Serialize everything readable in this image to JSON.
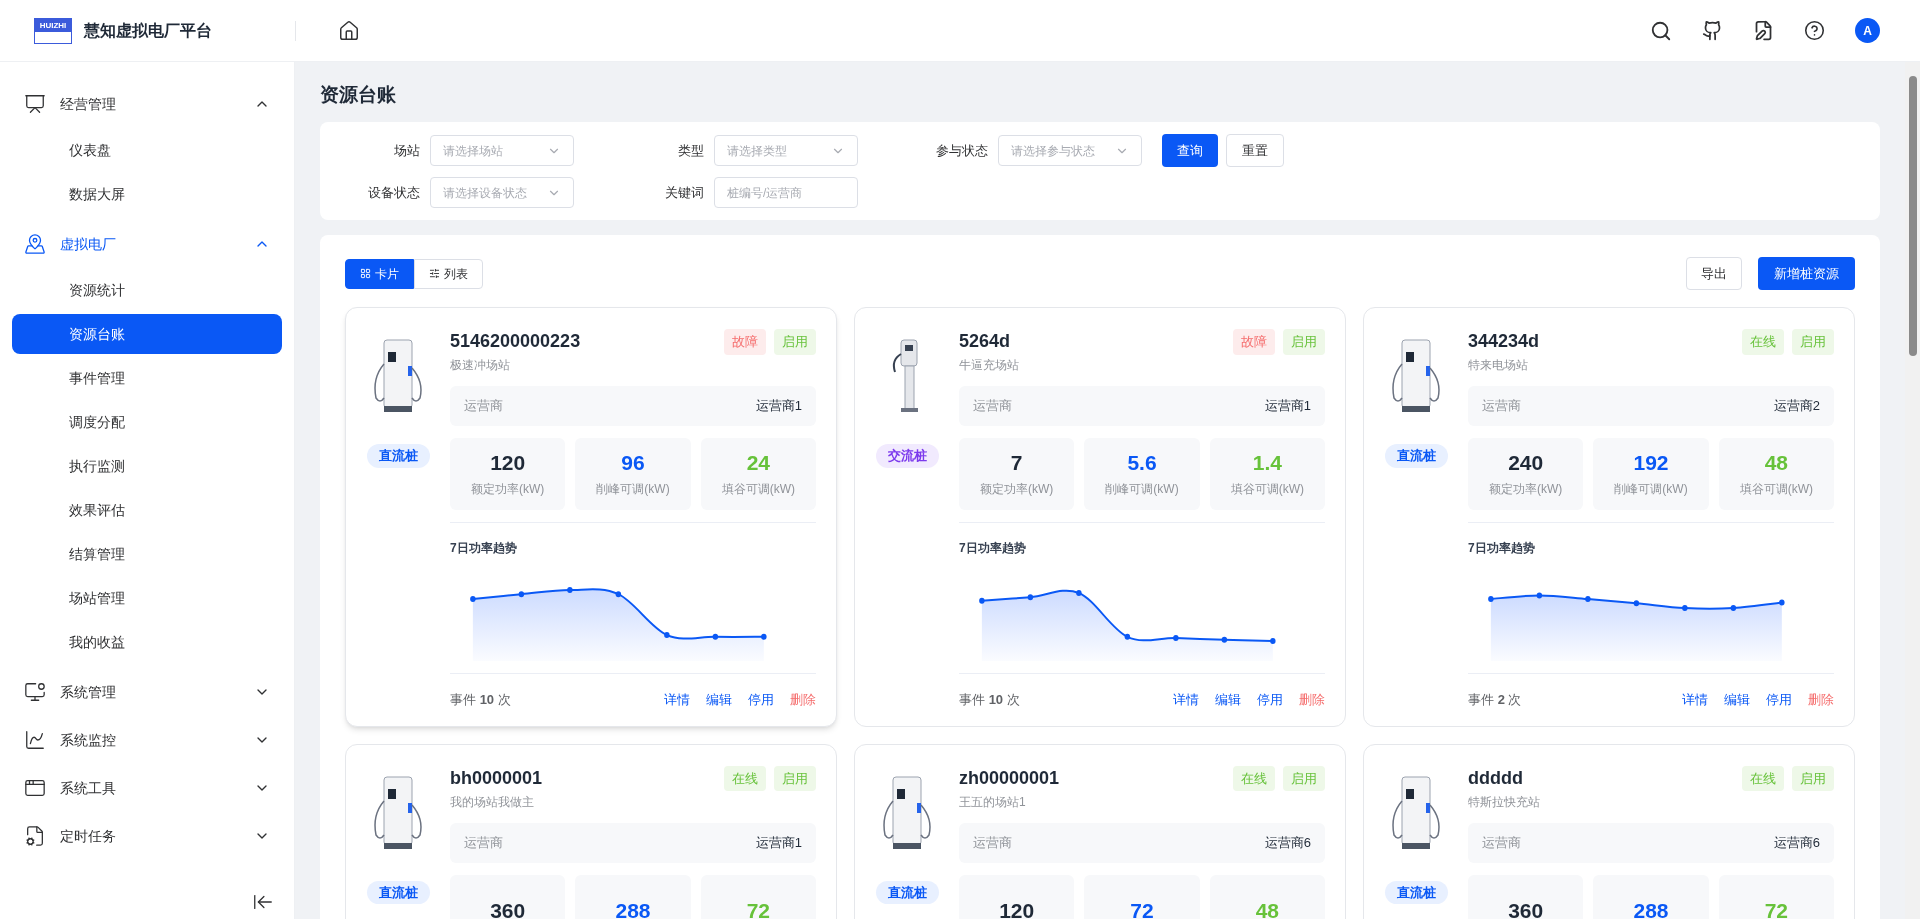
{
  "header": {
    "logo_text": "HUIZHI",
    "app_title": "慧知虚拟电厂平台",
    "avatar": "A"
  },
  "sidebar": {
    "groups": [
      {
        "label": "经营管理",
        "expanded": true,
        "active": false,
        "children": [
          {
            "label": "仪表盘",
            "selected": false
          },
          {
            "label": "数据大屏",
            "selected": false
          }
        ]
      },
      {
        "label": "虚拟电厂",
        "expanded": true,
        "active": true,
        "children": [
          {
            "label": "资源统计",
            "selected": false
          },
          {
            "label": "资源台账",
            "selected": true
          },
          {
            "label": "事件管理",
            "selected": false
          },
          {
            "label": "调度分配",
            "selected": false
          },
          {
            "label": "执行监测",
            "selected": false
          },
          {
            "label": "效果评估",
            "selected": false
          },
          {
            "label": "结算管理",
            "selected": false
          },
          {
            "label": "场站管理",
            "selected": false
          },
          {
            "label": "我的收益",
            "selected": false
          }
        ]
      },
      {
        "label": "系统管理",
        "expanded": false,
        "active": false
      },
      {
        "label": "系统监控",
        "expanded": false,
        "active": false
      },
      {
        "label": "系统工具",
        "expanded": false,
        "active": false
      },
      {
        "label": "定时任务",
        "expanded": false,
        "active": false
      }
    ]
  },
  "page_title": "资源台账",
  "filters": {
    "fields": [
      {
        "label": "场站",
        "kind": "select",
        "placeholder": "请选择场站"
      },
      {
        "label": "类型",
        "kind": "select",
        "placeholder": "请选择类型"
      },
      {
        "label": "参与状态",
        "kind": "select",
        "placeholder": "请选择参与状态"
      },
      {
        "label": "设备状态",
        "kind": "select",
        "placeholder": "请选择设备状态"
      },
      {
        "label": "关键词",
        "kind": "input",
        "placeholder": "桩编号/运营商"
      }
    ],
    "query_button": "查询",
    "reset_button": "重置"
  },
  "view_tabs": [
    {
      "label": "卡片",
      "selected": true
    },
    {
      "label": "列表",
      "selected": false
    }
  ],
  "export_button": "导出",
  "add_button": "新增桩资源",
  "cards": [
    {
      "id": "5146200000223",
      "station": "极速冲场站",
      "type": {
        "label": "直流桩",
        "kind": "dc"
      },
      "tags": [
        {
          "label": "故障",
          "kind": "fault"
        },
        {
          "label": "启用",
          "kind": "enabled"
        }
      ],
      "operator_label": "运营商",
      "operator": "运营商1",
      "stats": [
        {
          "value": "120",
          "label": "额定功率(kW)",
          "kind": "rated"
        },
        {
          "value": "96",
          "label": "削峰可调(kW)",
          "kind": "peak"
        },
        {
          "value": "24",
          "label": "填谷可调(kW)",
          "kind": "valley"
        }
      ],
      "chart_title": "7日功率趋势",
      "events": "事件 **10** 次",
      "actions": [
        {
          "label": "详情",
          "kind": "normal"
        },
        {
          "label": "编辑",
          "kind": "normal"
        },
        {
          "label": "停用",
          "kind": "normal"
        },
        {
          "label": "删除",
          "kind": "danger"
        }
      ]
    },
    {
      "id": "5264d",
      "station": "牛逼充场站",
      "type": {
        "label": "交流桩",
        "kind": "ac"
      },
      "tags": [
        {
          "label": "故障",
          "kind": "fault"
        },
        {
          "label": "启用",
          "kind": "enabled"
        }
      ],
      "operator_label": "运营商",
      "operator": "运营商1",
      "stats": [
        {
          "value": "7",
          "label": "额定功率(kW)",
          "kind": "rated"
        },
        {
          "value": "5.6",
          "label": "削峰可调(kW)",
          "kind": "peak"
        },
        {
          "value": "1.4",
          "label": "填谷可调(kW)",
          "kind": "valley"
        }
      ],
      "chart_title": "7日功率趋势",
      "events": "事件 **10** 次",
      "actions": [
        {
          "label": "详情",
          "kind": "normal"
        },
        {
          "label": "编辑",
          "kind": "normal"
        },
        {
          "label": "停用",
          "kind": "normal"
        },
        {
          "label": "删除",
          "kind": "danger"
        }
      ]
    },
    {
      "id": "344234d",
      "station": "特来电场站",
      "type": {
        "label": "直流桩",
        "kind": "dc"
      },
      "tags": [
        {
          "label": "在线",
          "kind": "online"
        },
        {
          "label": "启用",
          "kind": "enabled"
        }
      ],
      "operator_label": "运营商",
      "operator": "运营商2",
      "stats": [
        {
          "value": "240",
          "label": "额定功率(kW)",
          "kind": "rated"
        },
        {
          "value": "192",
          "label": "削峰可调(kW)",
          "kind": "peak"
        },
        {
          "value": "48",
          "label": "填谷可调(kW)",
          "kind": "valley"
        }
      ],
      "chart_title": "7日功率趋势",
      "events": "事件 **2** 次",
      "actions": [
        {
          "label": "详情",
          "kind": "normal"
        },
        {
          "label": "编辑",
          "kind": "normal"
        },
        {
          "label": "停用",
          "kind": "normal"
        },
        {
          "label": "删除",
          "kind": "danger"
        }
      ]
    },
    {
      "id": "bh0000001",
      "station": "我的场站我做主",
      "type": {
        "label": "直流桩",
        "kind": "dc"
      },
      "tags": [
        {
          "label": "在线",
          "kind": "online"
        },
        {
          "label": "启用",
          "kind": "enabled"
        }
      ],
      "operator_label": "运营商",
      "operator": "运营商1",
      "stats": [
        {
          "value": "360",
          "kind": "rated"
        },
        {
          "value": "288",
          "kind": "peak"
        },
        {
          "value": "72",
          "kind": "valley"
        }
      ]
    },
    {
      "id": "zh00000001",
      "station": "王五的场站1",
      "type": {
        "label": "直流桩",
        "kind": "dc"
      },
      "tags": [
        {
          "label": "在线",
          "kind": "online"
        },
        {
          "label": "启用",
          "kind": "enabled"
        }
      ],
      "operator_label": "运营商",
      "operator": "运营商6",
      "stats": [
        {
          "value": "120",
          "kind": "rated"
        },
        {
          "value": "72",
          "kind": "peak"
        },
        {
          "value": "48",
          "kind": "valley"
        }
      ]
    },
    {
      "id": "ddddd",
      "station": "特斯拉快充站",
      "type": {
        "label": "直流桩",
        "kind": "dc"
      },
      "tags": [
        {
          "label": "在线",
          "kind": "online"
        },
        {
          "label": "启用",
          "kind": "enabled"
        }
      ],
      "operator_label": "运营商",
      "operator": "运营商6",
      "stats": [
        {
          "value": "360",
          "kind": "rated"
        },
        {
          "value": "288",
          "kind": "peak"
        },
        {
          "value": "72",
          "kind": "valley"
        }
      ]
    }
  ]
}
